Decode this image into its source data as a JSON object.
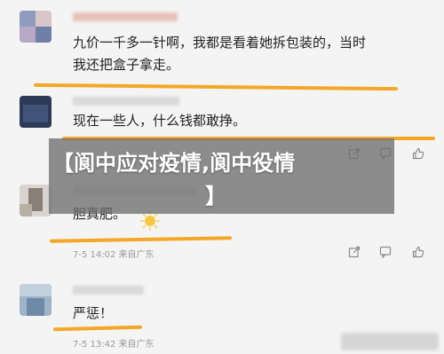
{
  "comments": [
    {
      "text_lines": [
        "九价一千多一针啊，我都是看着她拆包装的，当时",
        "我还把盒子拿走。"
      ],
      "meta": ""
    },
    {
      "text_lines": [
        "现在一些人，什么钱都敢挣。"
      ],
      "meta": ""
    },
    {
      "text_lines": [
        "胆真肥。"
      ],
      "meta": "7-5 14:02 来自广东"
    },
    {
      "text_lines": [
        "严惩！"
      ],
      "meta": "7-5 13:42 来自广东"
    }
  ],
  "banner": {
    "line1": "【阆中应对疫情,阆中役情",
    "line2": "】"
  },
  "icons": [
    "share-icon",
    "comment-icon",
    "like-icon"
  ],
  "colors": {
    "highlight": "#f3a21b",
    "banner_bg": "#6e6e6e",
    "meta_text": "#9a9a9a"
  }
}
